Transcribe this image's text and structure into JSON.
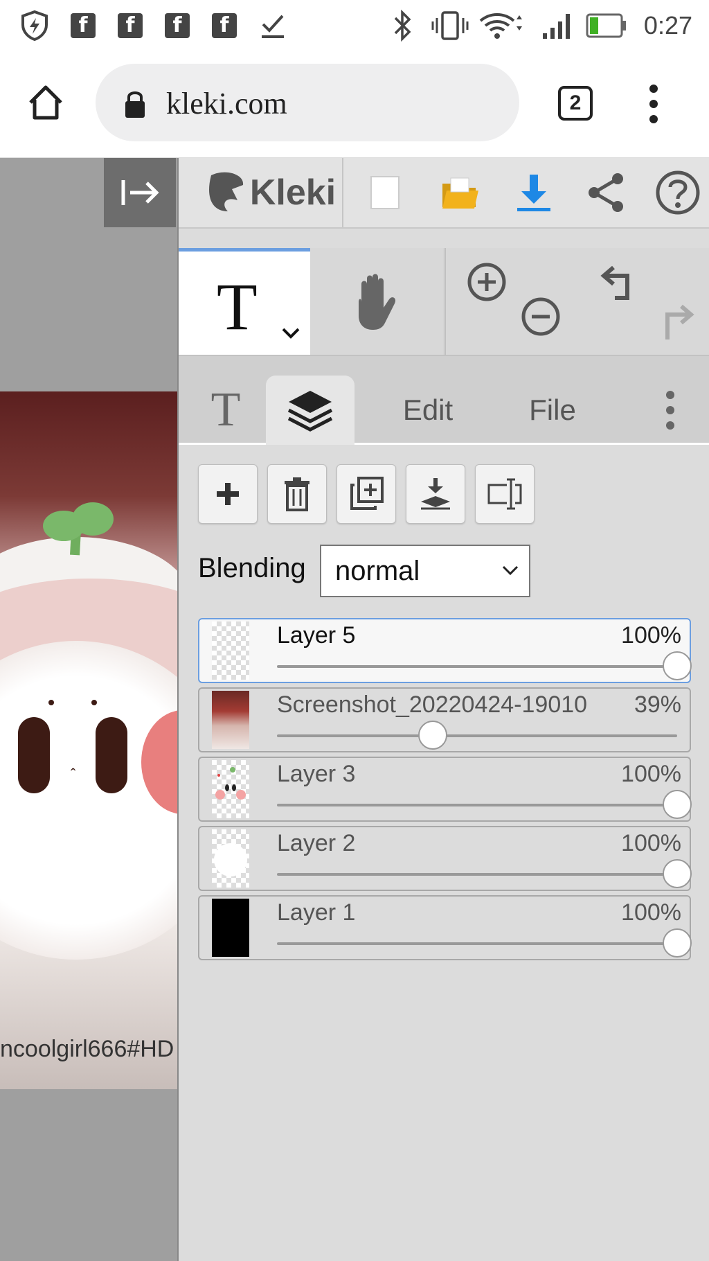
{
  "status_bar": {
    "clock": "0:27"
  },
  "browser": {
    "url": "kleki.com",
    "tab_count": "2"
  },
  "canvas": {
    "watermark": "ncoolgirl666#HD"
  },
  "app": {
    "logo_text": "Kleki"
  },
  "tabs": {
    "edit_label": "Edit",
    "file_label": "File"
  },
  "blending": {
    "label": "Blending",
    "selected": "normal"
  },
  "layers": [
    {
      "name": "Layer 5",
      "opacity": "100%",
      "opacity_value": 1.0,
      "selected": true
    },
    {
      "name": "Screenshot_20220424-19010",
      "opacity": "39%",
      "opacity_value": 0.39,
      "selected": false
    },
    {
      "name": "Layer 3",
      "opacity": "100%",
      "opacity_value": 1.0,
      "selected": false
    },
    {
      "name": "Layer 2",
      "opacity": "100%",
      "opacity_value": 1.0,
      "selected": false
    },
    {
      "name": "Layer 1",
      "opacity": "100%",
      "opacity_value": 1.0,
      "selected": false
    }
  ],
  "colors": {
    "accent": "#6b9ee0",
    "download": "#1e88e5",
    "folder": "#f2b21c"
  }
}
